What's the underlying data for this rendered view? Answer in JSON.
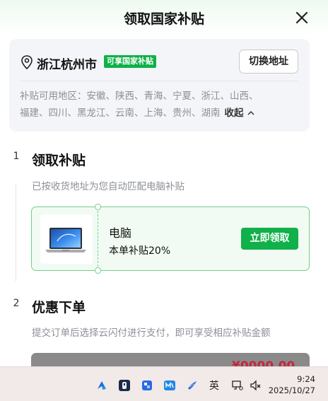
{
  "header": {
    "title": "领取国家补贴"
  },
  "address": {
    "city": "浙江杭州市",
    "badge": "可享国家补贴",
    "switch_label": "切换地址",
    "regions_line1": "补贴可用地区：安徽、陕西、青海、宁夏、浙江、山西、",
    "regions_line2": "福建、四川、黑龙江、云南、上海、贵州、湖南",
    "collapse_label": "收起"
  },
  "steps": [
    {
      "num": "1",
      "title": "领取补贴",
      "desc": "已按收货地址为您自动匹配电脑补贴"
    },
    {
      "num": "2",
      "title": "优惠下单",
      "desc": "提交订单后选择云闪付进行支付，即可享受相应补贴金额"
    }
  ],
  "coupon": {
    "name": "电脑",
    "rate": "本单补贴20%",
    "claim_label": "立即领取"
  },
  "order": {
    "price_partial": "¥0000.00"
  },
  "taskbar": {
    "ime_label": "英",
    "time": "9:24",
    "date": "2025/10/27"
  },
  "colors": {
    "accent": "#10b04a",
    "price": "#c8233a"
  }
}
